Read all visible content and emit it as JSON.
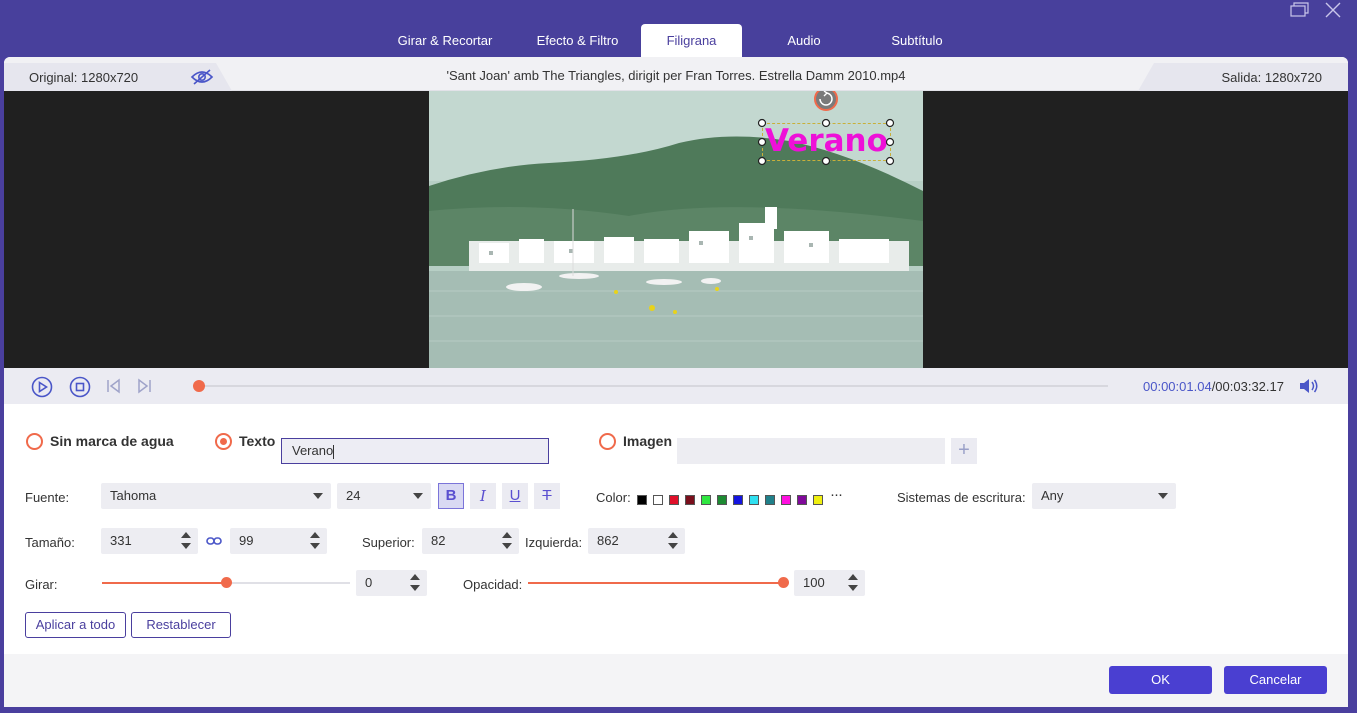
{
  "tabs": [
    {
      "label": "Girar & Recortar"
    },
    {
      "label": "Efecto & Filtro"
    },
    {
      "label": "Filigrana"
    },
    {
      "label": "Audio"
    },
    {
      "label": "Subtítulo"
    }
  ],
  "infobar": {
    "original": "Original: 1280x720",
    "filename": "'Sant Joan' amb The Triangles, dirigit per Fran Torres. Estrella Damm 2010.mp4",
    "output": "Salida: 1280x720"
  },
  "watermark_preview": {
    "text": "Verano",
    "color": "#ee10d8"
  },
  "playback": {
    "current": "00:00:01.04",
    "total": "/00:03:32.17",
    "progress": 0.005
  },
  "watermark": {
    "none_label": "Sin marca de agua",
    "text_label": "Texto",
    "text_value": "Verano",
    "image_label": "Imagen",
    "add_symbol": "+"
  },
  "font": {
    "label": "Fuente:",
    "family": "Tahoma",
    "size": "24",
    "bold": "B",
    "italic": "I",
    "underline": "U",
    "strike": "T",
    "color_label": "Color:",
    "colors": [
      "#000000",
      "#ffffff",
      "#e0102a",
      "#7a0f1c",
      "#2fe640",
      "#1d8a32",
      "#1414e0",
      "#30e0f0",
      "#20808a",
      "#ff10e0",
      "#800a9a",
      "#f0f010"
    ],
    "more": "···",
    "script_label": "Sistemas de escritura:",
    "script_value": "Any"
  },
  "size": {
    "label": "Tamaño:",
    "width": "331",
    "height": "99",
    "top_label": "Superior:",
    "top_value": "82",
    "left_label": "Izquierda:",
    "left_value": "862"
  },
  "rotate": {
    "label": "Girar:",
    "value": "0",
    "slider": 0.5
  },
  "opacity": {
    "label": "Opacidad:",
    "value": "100",
    "slider": 1.0
  },
  "actions": {
    "apply_all": "Aplicar a todo",
    "reset": "Restablecer"
  },
  "footer": {
    "ok": "OK",
    "cancel": "Cancelar"
  },
  "colors": {
    "accent": "#4a3f9e",
    "primary_button": "#4a3fd1",
    "orange": "#f06a4b"
  }
}
